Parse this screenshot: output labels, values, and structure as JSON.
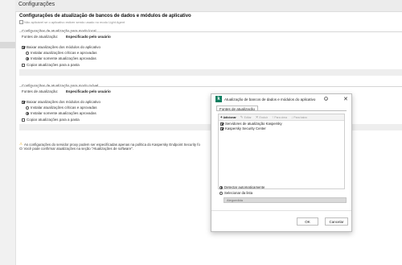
{
  "topbar": {
    "title": "Configurações"
  },
  "page": {
    "heading": "Configurações de atualização de bancos de dados e módulos de aplicativo",
    "subtitle": "Não aplicável se o aplicativo estiver sendo usado no modo Light Agent"
  },
  "section1": {
    "title": "Configurações de atualização para modo local",
    "source_label": "Fontes de atualização:",
    "source_value": "Especificado pelo usuário",
    "download_modules": "Baixar atualizações dos módulos do aplicativo",
    "install_critical": "Instalar atualizações críticas e aprovadas",
    "install_approved": "Instalar somente atualizações aprovadas",
    "copy_to_folder": "Copiar atualizações para a pasta"
  },
  "section2": {
    "title": "Configurações de atualização para modo móvel",
    "source_label": "Fontes de atualização:",
    "source_value": "Especificado pelo usuário",
    "download_modules": "Baixar atualizações dos módulos do aplicativo",
    "install_critical": "Instalar atualizações críticas e aprovadas",
    "install_approved": "Instalar somente atualizações aprovadas",
    "copy_to_folder": "Copiar atualizações para a pasta"
  },
  "notes": {
    "warning": "As configurações do servidor proxy podem ser especificadas apenas na política do Kaspersky Endpoint Security fo",
    "info": "Você pode confirmar atualizações na seção \"Atualizações de software\"."
  },
  "modal": {
    "title": "Atualização de bancos de dados e módulos do aplicativo",
    "help": "?",
    "close": "✕",
    "tab": "Fontes de atualização",
    "toolbar": {
      "add": "Adicionar",
      "edit": "Editar",
      "delete": "Excluir",
      "move_up": "Para cima",
      "move_down": "Para baixo"
    },
    "sources": [
      {
        "label": "Servidores de atualização Kaspersky",
        "checked": true
      },
      {
        "label": "Kaspersky Security Center",
        "checked": true
      }
    ],
    "detect_auto": "Detectar automaticamente",
    "select_from_list": "Selecionar da lista",
    "url_placeholder": "Alegoedida",
    "ok": "OK",
    "cancel": "Cancelar"
  },
  "colors": {
    "logo": "#0b7d5f",
    "warning": "#e0a000"
  }
}
